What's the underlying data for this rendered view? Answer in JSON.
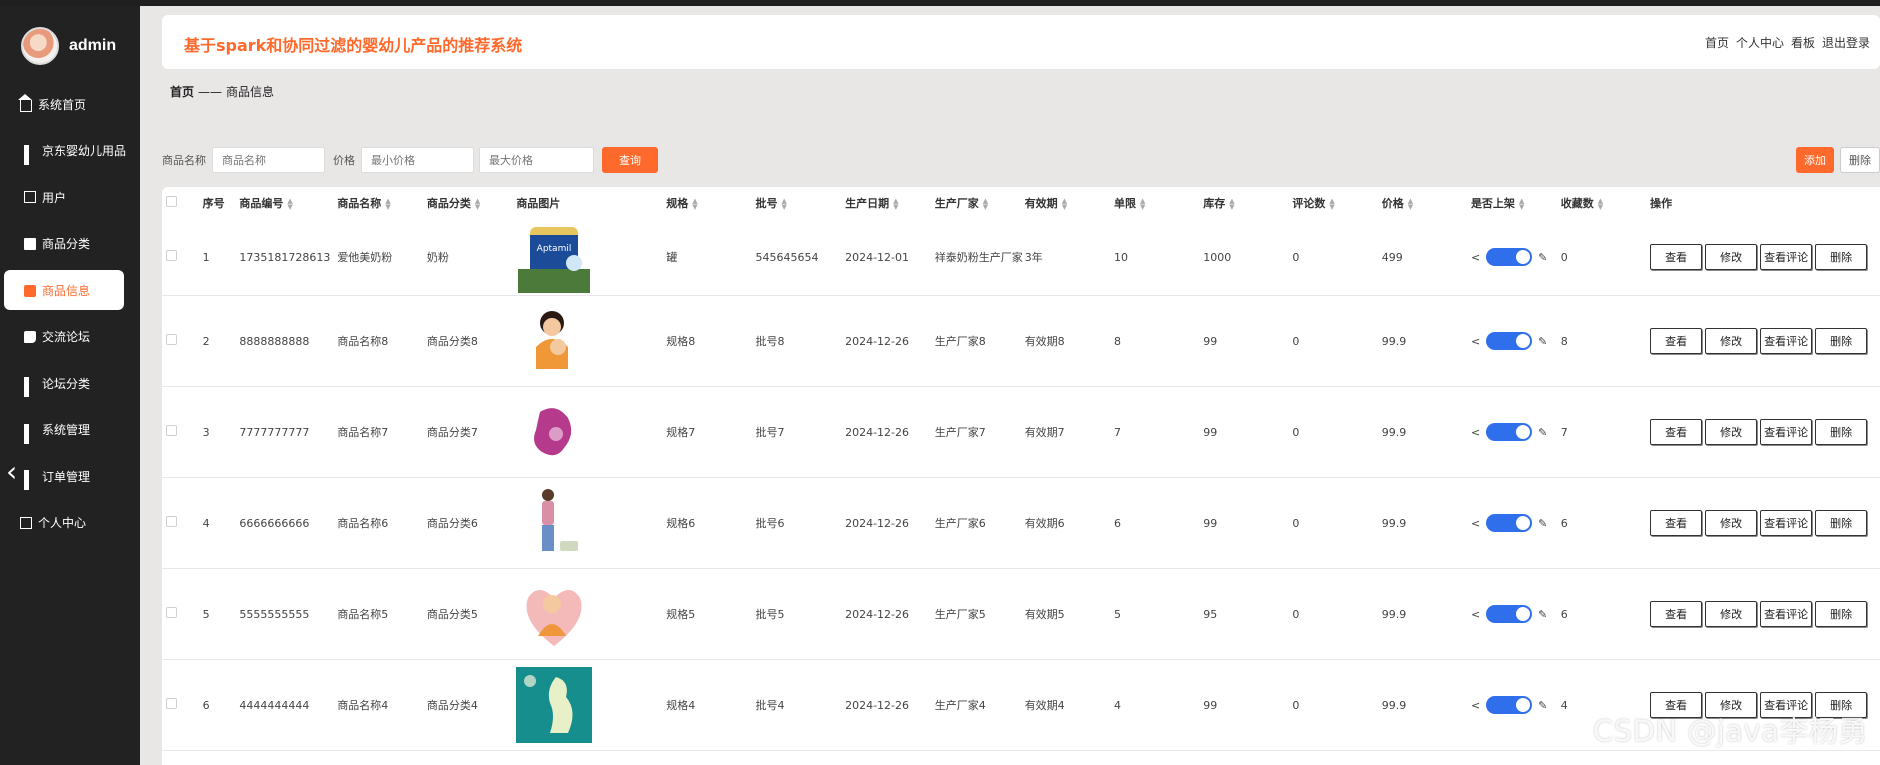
{
  "sidebar": {
    "username": "admin",
    "items": [
      {
        "label": "系统首页",
        "icon": "home-icon"
      },
      {
        "label": "京东婴幼儿用品",
        "icon": "grid-icon"
      },
      {
        "label": "用户",
        "icon": "square-icon"
      },
      {
        "label": "商品分类",
        "icon": "card-icon"
      },
      {
        "label": "商品信息",
        "icon": "bag-icon",
        "active": true
      },
      {
        "label": "交流论坛",
        "icon": "thumb-icon"
      },
      {
        "label": "论坛分类",
        "icon": "grid-icon"
      },
      {
        "label": "系统管理",
        "icon": "grid-icon"
      },
      {
        "label": "订单管理",
        "icon": "grid-icon"
      },
      {
        "label": "个人中心",
        "icon": "calendar-icon"
      }
    ]
  },
  "header": {
    "title": "基于spark和协同过滤的婴幼儿产品的推荐系统",
    "links": [
      "首页",
      "个人中心",
      "看板",
      "退出登录"
    ]
  },
  "breadcrumb": {
    "home": "首页",
    "sep": "——",
    "current": "商品信息"
  },
  "search": {
    "name_label": "商品名称",
    "name_placeholder": "商品名称",
    "price_label": "价格",
    "min_placeholder": "最小价格",
    "max_placeholder": "最大价格",
    "query_label": "查询",
    "add_label": "添加",
    "delete_label": "删除"
  },
  "table": {
    "columns": [
      "序号",
      "商品编号",
      "商品名称",
      "商品分类",
      "商品图片",
      "规格",
      "批号",
      "生产日期",
      "生产厂家",
      "有效期",
      "单限",
      "库存",
      "评论数",
      "价格",
      "是否上架",
      "收藏数",
      "操作"
    ],
    "op_labels": [
      "查看",
      "修改",
      "查看评论",
      "删除"
    ],
    "rows": [
      {
        "no": "1",
        "code": "1735181728613",
        "name": "爱他美奶粉",
        "category": "奶粉",
        "spec": "罐",
        "batch": "545645654",
        "date": "2024-12-01",
        "maker": "祥泰奶粉生产厂家",
        "validity": "3年",
        "limit": "10",
        "stock": "1000",
        "comments": "0",
        "price": "499",
        "on_sale": true,
        "fav": "0"
      },
      {
        "no": "2",
        "code": "8888888888",
        "name": "商品名称8",
        "category": "商品分类8",
        "spec": "规格8",
        "batch": "批号8",
        "date": "2024-12-26",
        "maker": "生产厂家8",
        "validity": "有效期8",
        "limit": "8",
        "stock": "99",
        "comments": "0",
        "price": "99.9",
        "on_sale": true,
        "fav": "8"
      },
      {
        "no": "3",
        "code": "7777777777",
        "name": "商品名称7",
        "category": "商品分类7",
        "spec": "规格7",
        "batch": "批号7",
        "date": "2024-12-26",
        "maker": "生产厂家7",
        "validity": "有效期7",
        "limit": "7",
        "stock": "99",
        "comments": "0",
        "price": "99.9",
        "on_sale": true,
        "fav": "7"
      },
      {
        "no": "4",
        "code": "6666666666",
        "name": "商品名称6",
        "category": "商品分类6",
        "spec": "规格6",
        "batch": "批号6",
        "date": "2024-12-26",
        "maker": "生产厂家6",
        "validity": "有效期6",
        "limit": "6",
        "stock": "99",
        "comments": "0",
        "price": "99.9",
        "on_sale": true,
        "fav": "6"
      },
      {
        "no": "5",
        "code": "5555555555",
        "name": "商品名称5",
        "category": "商品分类5",
        "spec": "规格5",
        "batch": "批号5",
        "date": "2024-12-26",
        "maker": "生产厂家5",
        "validity": "有效期5",
        "limit": "5",
        "stock": "95",
        "comments": "0",
        "price": "99.9",
        "on_sale": true,
        "fav": "6"
      },
      {
        "no": "6",
        "code": "4444444444",
        "name": "商品名称4",
        "category": "商品分类4",
        "spec": "规格4",
        "batch": "批号4",
        "date": "2024-12-26",
        "maker": "生产厂家4",
        "validity": "有效期4",
        "limit": "4",
        "stock": "99",
        "comments": "0",
        "price": "99.9",
        "on_sale": true,
        "fav": "4"
      }
    ]
  },
  "watermark": "CSDN @java李杨勇",
  "colors": {
    "accent": "#ff6a2c",
    "toggle": "#2f6fec",
    "sidebar": "#222222"
  }
}
